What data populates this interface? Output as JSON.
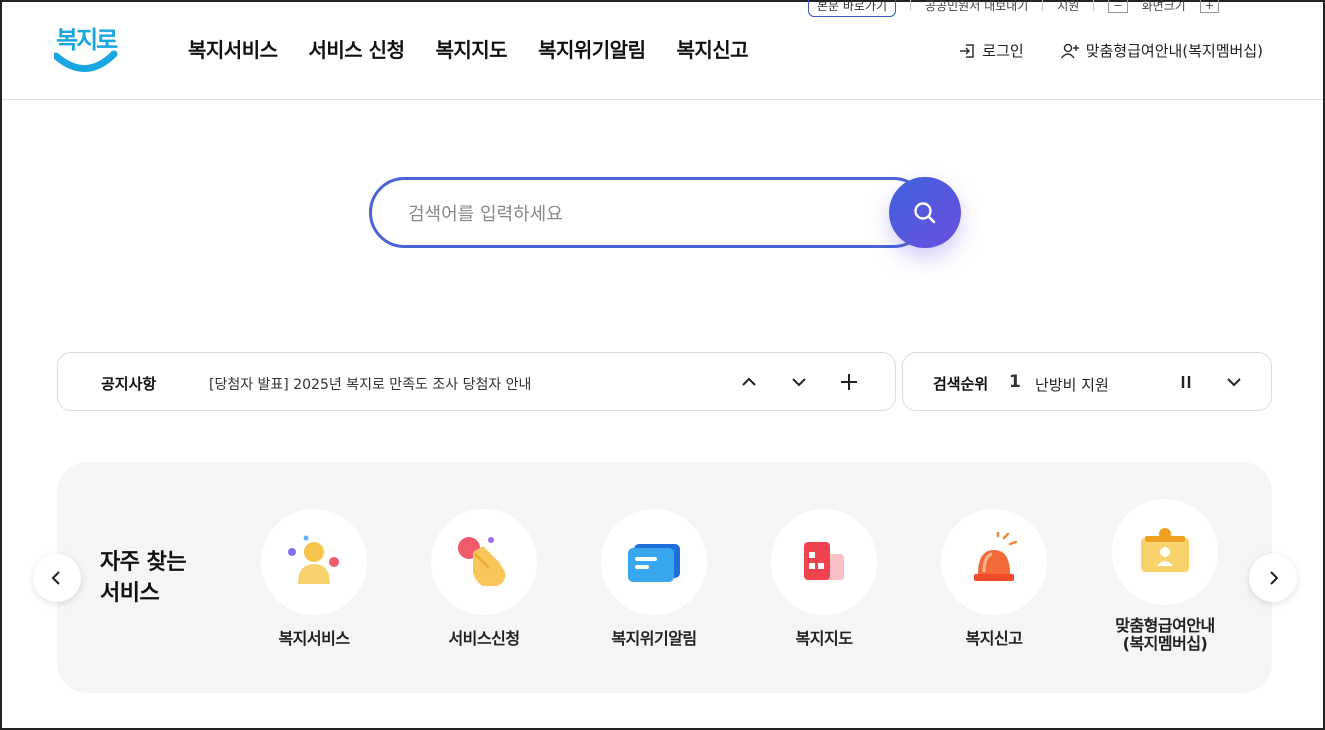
{
  "util": {
    "btn1": "본문 바로가기",
    "link1": "공공민원서 내보내기",
    "link2": "지원",
    "size_label": "화면크기"
  },
  "header": {
    "logo_text": "복지로",
    "nav": [
      "복지서비스",
      "서비스 신청",
      "복지지도",
      "복지위기알림",
      "복지신고"
    ],
    "login": "로그인",
    "membership": "맞춤형급여안내(복지멤버십)"
  },
  "search": {
    "placeholder": "검색어를 입력하세요",
    "value": ""
  },
  "notice": {
    "label": "공지사항",
    "text": "[당첨자 발표] 2025년 복지로 만족도 조사 당첨자 안내"
  },
  "ranking": {
    "label": "검색순위",
    "rank": "1",
    "keyword": "난방비 지원"
  },
  "frequent": {
    "title_line1": "자주 찾는",
    "title_line2": "서비스",
    "items": [
      {
        "label": "복지서비스",
        "icon": "person-icon"
      },
      {
        "label": "서비스신청",
        "icon": "tap-hand-icon"
      },
      {
        "label": "복지위기알림",
        "icon": "message-icon"
      },
      {
        "label": "복지지도",
        "icon": "map-building-icon"
      },
      {
        "label": "복지신고",
        "icon": "siren-icon"
      },
      {
        "label": "맞춤형급여안내\n(복지멤버십)",
        "label_line1": "맞춤형급여안내",
        "label_line2": "(복지멤버십)",
        "icon": "id-badge-icon"
      }
    ]
  },
  "colors": {
    "brand": "#1aa6e0",
    "accent": "#4a63d6",
    "panel_bg": "#f5f5f5"
  }
}
